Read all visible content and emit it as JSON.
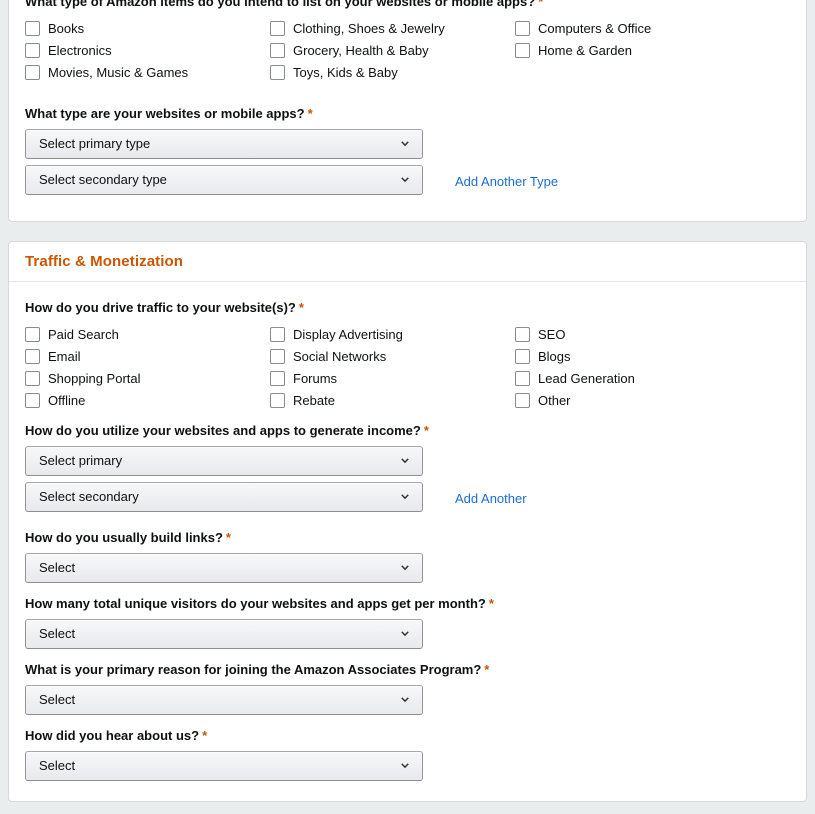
{
  "colors": {
    "page_background": "#eaeded",
    "card_background": "#ffffff",
    "card_border": "#d5d9d9",
    "section_title": "#cc5500",
    "required_asterisk": "#c45500",
    "link": "#1a6dd4",
    "text": "#0f1111",
    "checkbox_border": "#888c8c"
  },
  "required_marker": "*",
  "icons": {
    "chevron_down": "chevron-down-icon"
  },
  "sections": {
    "item_types": {
      "question": "What type of Amazon items do you intend to list on your websites or mobile apps?",
      "required": true,
      "options": [
        "Books",
        "Clothing, Shoes & Jewelry",
        "Computers & Office",
        "Electronics",
        "Grocery, Health & Baby",
        "Home & Garden",
        "Movies, Music & Games",
        "Toys, Kids & Baby"
      ]
    },
    "site_type": {
      "question": "What type are your websites or mobile apps?",
      "required": true,
      "primary_value": "Select primary type",
      "secondary_value": "Select secondary type",
      "add_link": "Add Another Type"
    },
    "traffic_monetization": {
      "title": "Traffic & Monetization",
      "traffic": {
        "question": "How do you drive traffic to your website(s)?",
        "required": true,
        "options": [
          "Paid Search",
          "Display Advertising",
          "SEO",
          "Email",
          "Social Networks",
          "Blogs",
          "Shopping Portal",
          "Forums",
          "Lead Generation",
          "Offline",
          "Rebate",
          "Other"
        ]
      },
      "income": {
        "question": "How do you utilize your websites and apps to generate income?",
        "required": true,
        "primary_value": "Select primary",
        "secondary_value": "Select secondary",
        "add_link": "Add Another"
      },
      "build_links": {
        "question": "How do you usually build links?",
        "required": true,
        "value": "Select"
      },
      "unique_visitors": {
        "question": "How many total unique visitors do your websites and apps get per month?",
        "required": true,
        "value": "Select"
      },
      "primary_reason": {
        "question": "What is your primary reason for joining the Amazon Associates Program?",
        "required": true,
        "value": "Select"
      },
      "hear_about_us": {
        "question": "How did you hear about us?",
        "required": true,
        "value": "Select"
      }
    }
  }
}
